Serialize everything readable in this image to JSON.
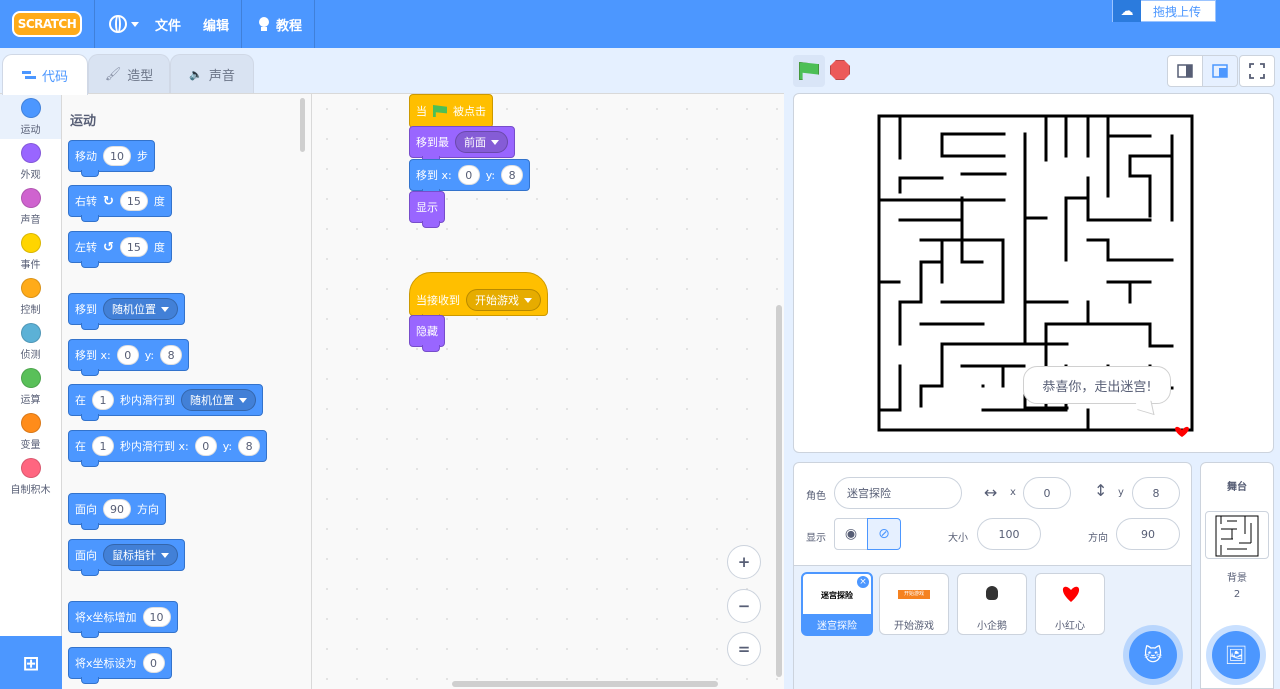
{
  "menubar": {
    "logo": "SCRATCH",
    "file": "文件",
    "edit": "编辑",
    "tutorials": "教程",
    "upload": "拖拽上传"
  },
  "tabs": {
    "code": "代码",
    "costumes": "造型",
    "sounds": "声音"
  },
  "categories": [
    {
      "label": "运动",
      "color": "#4c97ff"
    },
    {
      "label": "外观",
      "color": "#9966ff"
    },
    {
      "label": "声音",
      "color": "#cf63cf"
    },
    {
      "label": "事件",
      "color": "#ffd500"
    },
    {
      "label": "控制",
      "color": "#ffab19"
    },
    {
      "label": "侦测",
      "color": "#5cb1d6"
    },
    {
      "label": "运算",
      "color": "#59c059"
    },
    {
      "label": "变量",
      "color": "#ff8c1a"
    },
    {
      "label": "自制积木",
      "color": "#ff6680"
    }
  ],
  "palette": {
    "title": "运动",
    "move": {
      "a": "移动",
      "n": "10",
      "b": "步"
    },
    "turn_right": {
      "a": "右转",
      "n": "15",
      "b": "度"
    },
    "turn_left": {
      "a": "左转",
      "n": "15",
      "b": "度"
    },
    "goto": {
      "a": "移到",
      "dd": "随机位置"
    },
    "goto_xy": {
      "a": "移到 x:",
      "x": "0",
      "ylab": "y:",
      "y": "8"
    },
    "glide": {
      "a": "在",
      "n": "1",
      "b": "秒内滑行到",
      "dd": "随机位置"
    },
    "glide_xy": {
      "a": "在",
      "n": "1",
      "b": "秒内滑行到 x:",
      "x": "0",
      "ylab": "y:",
      "y": "8"
    },
    "point_dir": {
      "a": "面向",
      "n": "90",
      "b": "方向"
    },
    "point_towards": {
      "a": "面向",
      "dd": "鼠标指针"
    },
    "change_x": {
      "a": "将x坐标增加",
      "n": "10"
    },
    "set_x": {
      "a": "将x坐标设为",
      "n": "0"
    }
  },
  "script1": {
    "hat": {
      "a": "当",
      "b": "被点击"
    },
    "layer": {
      "a": "移到最",
      "dd": "前面"
    },
    "goto": {
      "a": "移到 x:",
      "x": "0",
      "ylab": "y:",
      "y": "8"
    },
    "show": "显示"
  },
  "script2": {
    "hat": {
      "a": "当接收到",
      "dd": "开始游戏"
    },
    "hide": "隐藏"
  },
  "zoom": {
    "in": "+",
    "out": "−",
    "reset": "="
  },
  "stage": {
    "bubble": "恭喜你，走出迷宫!"
  },
  "sprite_info": {
    "sprite_label": "角色",
    "sprite_name": "迷宫探险",
    "x_label": "x",
    "x": "0",
    "y_label": "y",
    "y": "8",
    "show_label": "显示",
    "size_label": "大小",
    "size": "100",
    "direction_label": "方向",
    "direction": "90"
  },
  "sprites": [
    {
      "name": "迷宫探险",
      "thumb_text": "迷宫探险",
      "selected": true
    },
    {
      "name": "开始游戏",
      "thumb_text": "开始游戏",
      "selected": false
    },
    {
      "name": "小企鹅",
      "thumb_text": "",
      "selected": false
    },
    {
      "name": "小红心",
      "thumb_text": "",
      "selected": false
    }
  ],
  "stage_panel": {
    "title": "舞台",
    "backdrop_label": "背景",
    "backdrop_count": "2"
  }
}
